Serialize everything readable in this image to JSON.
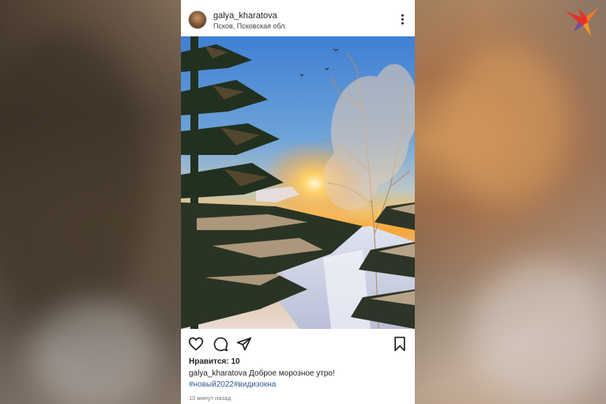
{
  "post": {
    "username": "galya_kharatova",
    "location": "Псков, Псковская обл.",
    "likes_text": "Нравится: 10",
    "caption_username": "galya_kharatova",
    "caption_text": "Доброе морозное утро!",
    "hashtags": "#новый2022#видизокна",
    "time_text": "10 минут назад"
  },
  "icons": {
    "like": "heart-icon",
    "comment": "comment-icon",
    "share": "send-icon",
    "save": "bookmark-icon",
    "more": "more-vertical-icon",
    "logo": "bird-logo-icon"
  },
  "colors": {
    "hashtag": "#2f5c8f",
    "logo_red": "#e4322b",
    "logo_orange": "#f39a2b",
    "logo_purple": "#6e4fa3"
  }
}
